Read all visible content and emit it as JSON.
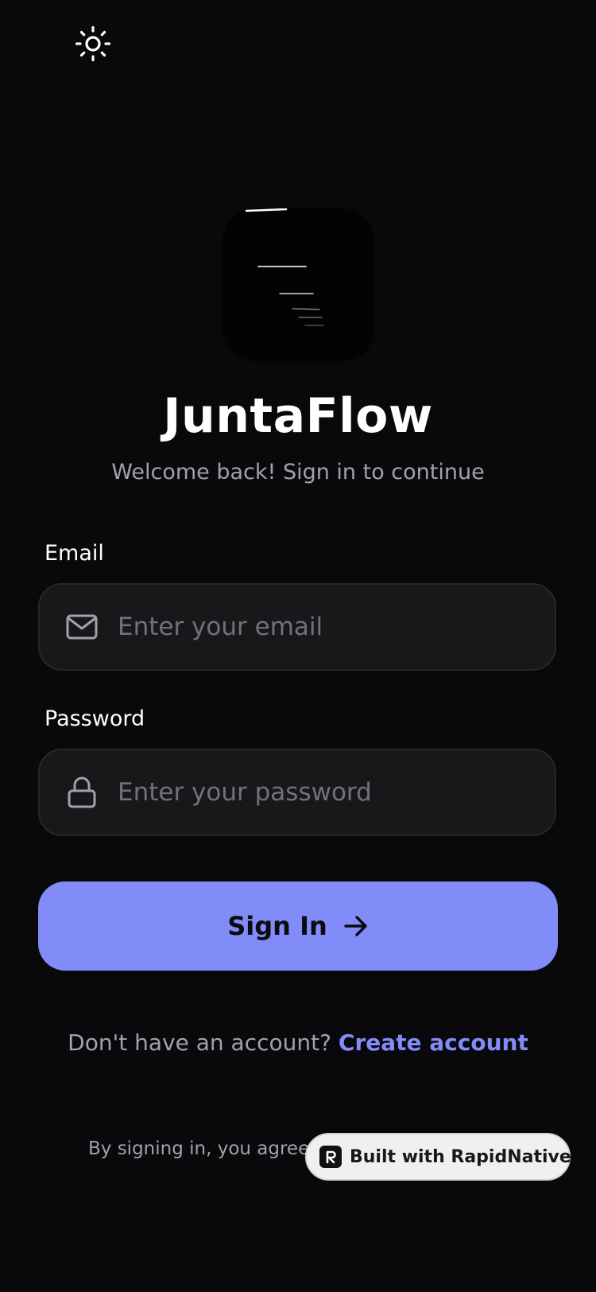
{
  "app": {
    "title": "JuntaFlow",
    "subtitle": "Welcome back! Sign in to continue"
  },
  "theme_toggle": {
    "icon": "sun-icon"
  },
  "form": {
    "email": {
      "label": "Email",
      "placeholder": "Enter your email",
      "value": "",
      "icon": "mail-icon"
    },
    "password": {
      "label": "Password",
      "placeholder": "Enter your password",
      "value": "",
      "icon": "lock-icon"
    },
    "submit_label": "Sign In",
    "submit_icon": "arrow-right-icon"
  },
  "signup": {
    "prompt": "Don't have an account?",
    "link_label": "Create account"
  },
  "footer": {
    "terms_text": "By signing in, you agree to"
  },
  "badge": {
    "label": "Built with RapidNative",
    "icon": "rapidnative-logo"
  },
  "colors": {
    "background": "#09090b",
    "accent": "#818cf8",
    "input_bg": "#18181b",
    "muted_text": "#a1a1aa",
    "placeholder": "#71717a"
  }
}
